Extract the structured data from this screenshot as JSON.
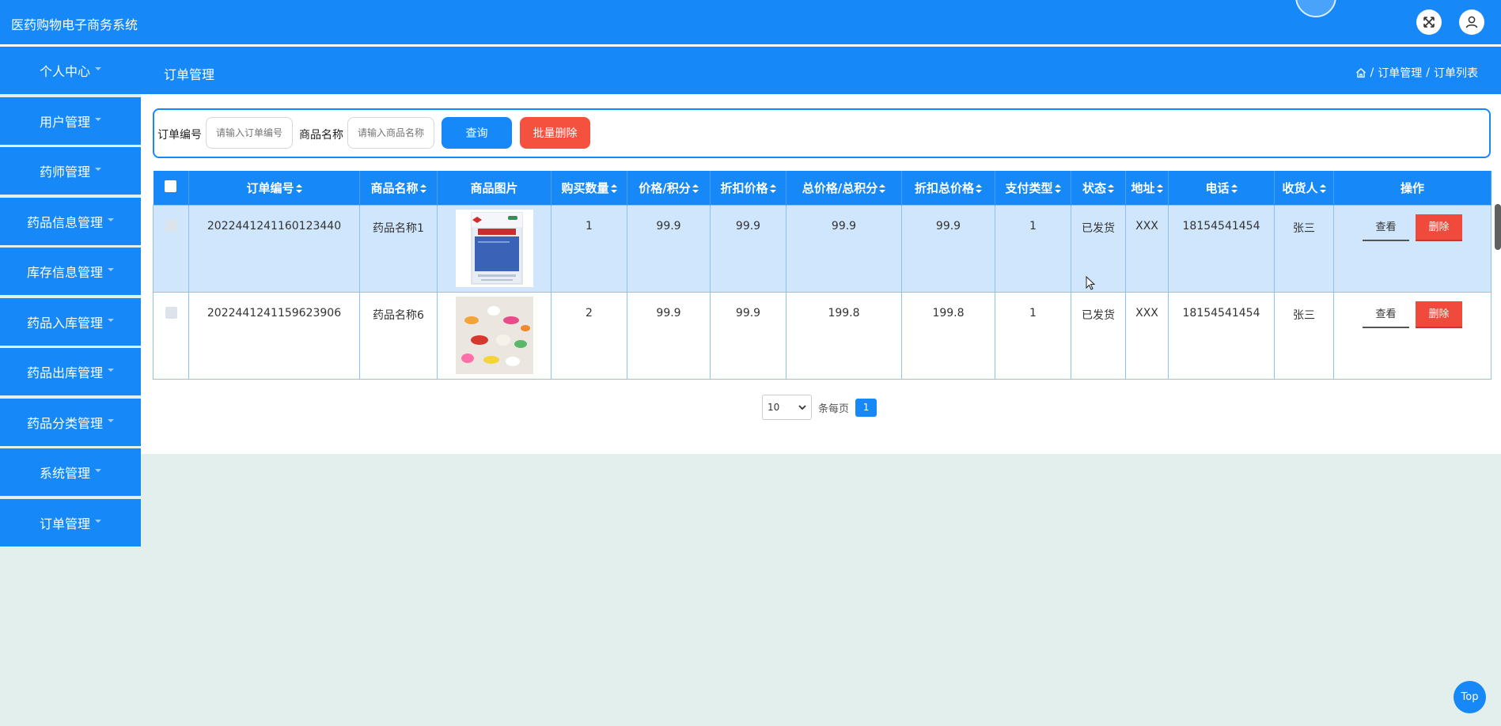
{
  "app": {
    "title": "医药购物电子商务系统"
  },
  "sidebar": {
    "items": [
      {
        "label": "个人中心"
      },
      {
        "label": "用户管理"
      },
      {
        "label": "药师管理"
      },
      {
        "label": "药品信息管理"
      },
      {
        "label": "库存信息管理"
      },
      {
        "label": "药品入库管理"
      },
      {
        "label": "药品出库管理"
      },
      {
        "label": "药品分类管理"
      },
      {
        "label": "系统管理"
      },
      {
        "label": "订单管理"
      }
    ]
  },
  "header": {
    "page_title": "订单管理",
    "breadcrumb": {
      "level1": "订单管理",
      "level2": "订单列表"
    }
  },
  "search": {
    "order_label": "订单编号",
    "order_placeholder": "请输入订单编号",
    "product_label": "商品名称",
    "product_placeholder": "请输入商品名称",
    "query_label": "查询",
    "batch_delete_label": "批量删除"
  },
  "table": {
    "columns": [
      "订单编号",
      "商品名称",
      "商品图片",
      "购买数量",
      "价格/积分",
      "折扣价格",
      "总价格/总积分",
      "折扣总价格",
      "支付类型",
      "状态",
      "地址",
      "电话",
      "收货人",
      "操作"
    ],
    "rows": [
      {
        "order_no": "2022441241160123440",
        "product": "药品名称1",
        "image": "medicine-box",
        "qty": "1",
        "price": "99.9",
        "discount": "99.9",
        "total": "99.9",
        "discount_total": "99.9",
        "pay_type": "1",
        "status": "已发货",
        "address": "XXX",
        "phone": "18154541454",
        "receiver": "张三"
      },
      {
        "order_no": "2022441241159623906",
        "product": "药品名称6",
        "image": "pills",
        "qty": "2",
        "price": "99.9",
        "discount": "99.9",
        "total": "199.8",
        "discount_total": "199.8",
        "pay_type": "1",
        "status": "已发货",
        "address": "XXX",
        "phone": "18154541454",
        "receiver": "张三"
      }
    ],
    "view_label": "查看",
    "delete_label": "删除"
  },
  "pagination": {
    "page_size": "10",
    "per_page_label": "条每页",
    "current_page": "1"
  },
  "top_button": {
    "label": "Top"
  },
  "colors": {
    "primary": "#1688f8",
    "danger": "#f04a3c",
    "highlight_row": "#cfe6fd",
    "background": "#e2efec"
  }
}
